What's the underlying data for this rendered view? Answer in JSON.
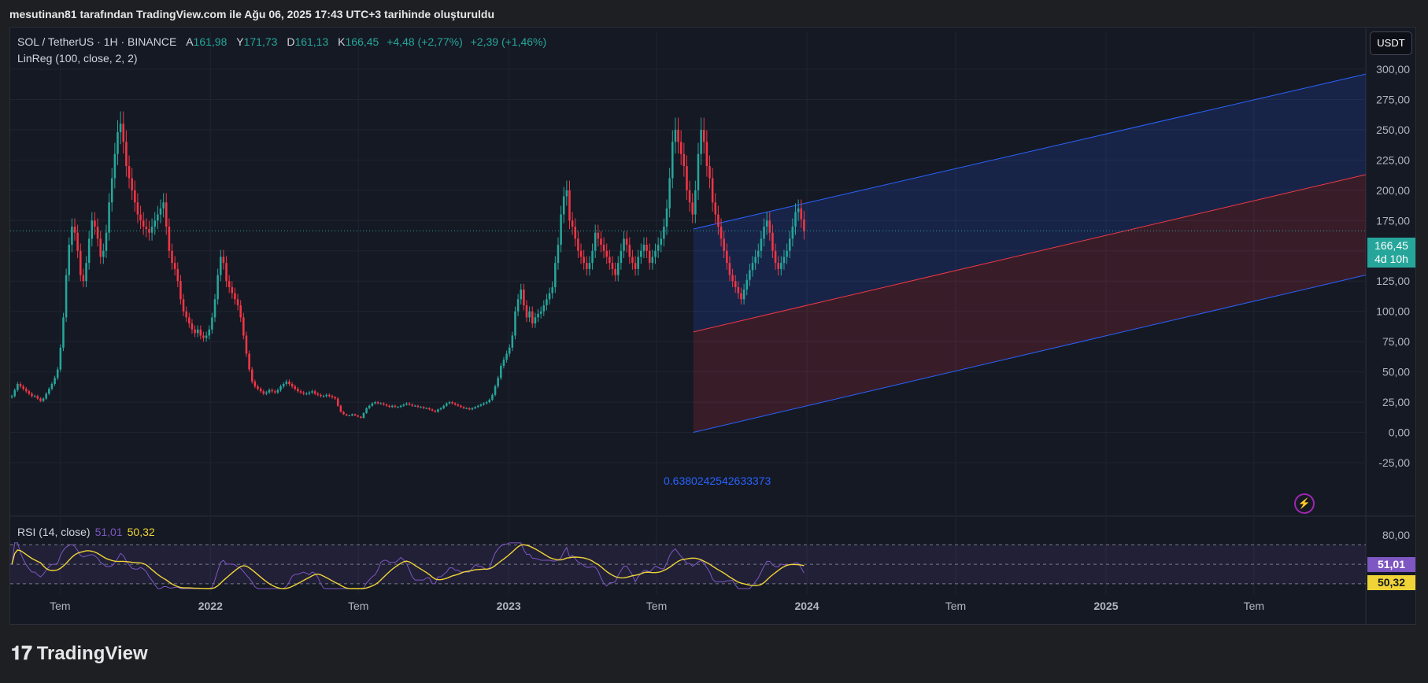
{
  "caption": "mesutinan81 tarafından TradingView.com ile Ağu 06, 2025 17:43 UTC+3 tarihinde oluşturuldu",
  "legend": {
    "symbol": "SOL / TetherUS · 1H · BINANCE",
    "open_label": "A",
    "open": "161,98",
    "high_label": "Y",
    "high": "171,73",
    "low_label": "D",
    "low": "161,13",
    "close_label": "K",
    "close": "166,45",
    "change": "+4,48 (+2,77%)",
    "change2": "+2,39 (+1,46%)"
  },
  "indicator": "LinReg (100, close, 2, 2)",
  "currency_button": "USDT",
  "price_tag": {
    "price": "166,45",
    "countdown": "4d 10h"
  },
  "annotation": "0.6380242542633373",
  "rsi": {
    "label": "RSI (14, close)",
    "value": "51,01",
    "ma": "50,32"
  },
  "footer_logo": "TradingView",
  "colors": {
    "up": "#26a69a",
    "down": "#f23645",
    "channel_line": "#2962ff",
    "regression_line": "#f23645",
    "rsi_line": "#7e57c2",
    "rsi_ma": "#f0d437",
    "bolt": "#9c27b0"
  },
  "chart_data": [
    {
      "type": "candlestick",
      "title": "SOL / TetherUS · 1H · BINANCE",
      "y_ticks": [
        "300,00",
        "275,00",
        "250,00",
        "225,00",
        "200,00",
        "175,00",
        "150,00",
        "125,00",
        "100,00",
        "75,00",
        "50,00",
        "25,00",
        "0,00",
        "-25,00"
      ],
      "y_tick_values": [
        300,
        275,
        250,
        225,
        200,
        175,
        150,
        125,
        100,
        75,
        50,
        25,
        0,
        -25
      ],
      "ylim": [
        -25,
        300
      ],
      "x_ticks": [
        "Tem",
        "2022",
        "Tem",
        "2023",
        "Tem",
        "2024",
        "Tem",
        "2025",
        "Tem"
      ],
      "x_tick_dates": [
        "2021-07",
        "2022-01",
        "2022-07",
        "2023-01",
        "2023-07",
        "2024-01",
        "2024-07",
        "2025-01",
        "2025-07"
      ],
      "xlim": [
        "2021-05-01",
        "2025-11-15"
      ],
      "last_price": 166.45,
      "grid": true,
      "linreg_channel": {
        "start_date": "2023-08-15",
        "end_date": "2025-11-15",
        "upper": [
          168,
          296
        ],
        "center": [
          83,
          213
        ],
        "lower": [
          0,
          130
        ]
      },
      "candle_interval_days": 3.5,
      "closes": [
        30,
        35,
        40,
        38,
        36,
        34,
        32,
        30,
        30,
        28,
        26,
        28,
        32,
        36,
        40,
        45,
        52,
        70,
        95,
        130,
        155,
        170,
        165,
        150,
        130,
        125,
        140,
        160,
        175,
        170,
        160,
        145,
        150,
        165,
        190,
        210,
        230,
        248,
        255,
        240,
        220,
        210,
        200,
        190,
        180,
        175,
        170,
        168,
        165,
        170,
        175,
        180,
        185,
        190,
        170,
        150,
        140,
        135,
        125,
        110,
        100,
        95,
        90,
        85,
        82,
        85,
        80,
        78,
        80,
        85,
        95,
        110,
        130,
        145,
        140,
        125,
        120,
        115,
        110,
        105,
        95,
        80,
        65,
        52,
        42,
        38,
        36,
        34,
        32,
        33,
        35,
        34,
        33,
        35,
        38,
        40,
        42,
        40,
        38,
        36,
        34,
        33,
        32,
        32,
        33,
        34,
        32,
        31,
        30,
        30,
        31,
        30,
        29,
        28,
        22,
        17,
        15,
        14,
        14,
        15,
        14,
        13,
        12,
        16,
        20,
        22,
        24,
        25,
        24,
        24,
        23,
        22,
        21,
        22,
        21,
        21,
        22,
        23,
        24,
        23,
        22,
        22,
        21,
        21,
        20,
        20,
        19,
        18,
        17,
        19,
        20,
        22,
        24,
        25,
        24,
        23,
        22,
        21,
        20,
        20,
        19,
        20,
        21,
        22,
        23,
        24,
        25,
        27,
        31,
        38,
        45,
        55,
        60,
        65,
        70,
        80,
        100,
        110,
        118,
        105,
        95,
        100,
        90,
        95,
        98,
        100,
        105,
        110,
        115,
        120,
        140,
        155,
        180,
        195,
        200,
        175,
        170,
        160,
        150,
        145,
        140,
        135,
        140,
        150,
        165,
        160,
        155,
        150,
        145,
        140,
        135,
        130,
        140,
        150,
        160,
        155,
        145,
        140,
        135,
        145,
        150,
        155,
        150,
        140,
        145,
        150,
        155,
        160,
        170,
        185,
        210,
        240,
        250,
        240,
        230,
        220,
        200,
        190,
        180,
        200,
        230,
        250,
        240,
        220,
        210,
        190,
        180,
        170,
        160,
        150,
        140,
        130,
        125,
        120,
        115,
        110,
        118,
        126,
        134,
        140,
        145,
        150,
        160,
        170,
        175,
        165,
        150,
        140,
        135,
        140,
        145,
        150,
        160,
        170,
        182,
        185,
        176,
        166
      ]
    },
    {
      "type": "line",
      "title": "RSI (14, close)",
      "y_ticks": [
        "80,00"
      ],
      "y_tick_values": [
        80
      ],
      "levels": [
        70,
        50,
        30
      ],
      "ylim": [
        25,
        80
      ],
      "last_rsi": 51.01,
      "last_ma": 50.32
    }
  ]
}
